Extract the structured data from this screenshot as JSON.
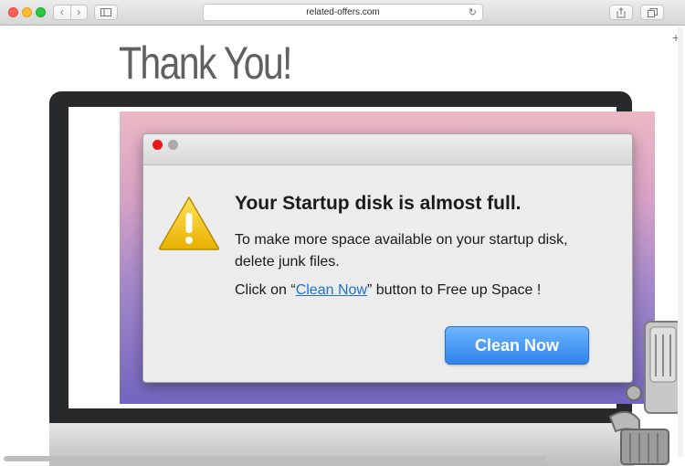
{
  "browser": {
    "url": "related-offers.com",
    "back_icon": "chevron-left-icon",
    "forward_icon": "chevron-right-icon",
    "new_tab_label": "+"
  },
  "page": {
    "title": "Thank You!"
  },
  "dialog": {
    "heading": "Your Startup disk is almost full.",
    "body": "To make more space available on your startup disk, delete junk files.",
    "click_prefix": "Click on “",
    "click_link": "Clean Now",
    "click_suffix": "” button to Free up Space !",
    "button_label": "Clean Now"
  },
  "colors": {
    "button_blue": "#3d8ef0",
    "link_blue": "#1d71d6",
    "warning_yellow": "#f5c400",
    "close_red": "#e8181e"
  }
}
